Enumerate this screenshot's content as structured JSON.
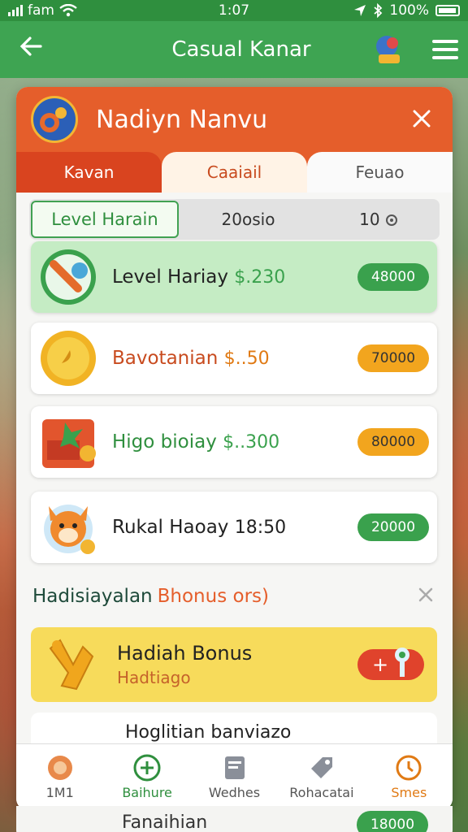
{
  "status_bar": {
    "carrier": "fam",
    "time": "1:07",
    "battery": "100%"
  },
  "app_bar": {
    "title": "Casual Kanar"
  },
  "dialog": {
    "title": "Nadiyn Nanvu",
    "tabs": [
      "Kavan",
      "Caaiail",
      "Feuao"
    ],
    "segments": [
      "Level Harain",
      "20osio",
      "10"
    ],
    "rewards": [
      {
        "name": "Level Hariay",
        "amount": "$.230",
        "value": "48000",
        "name_color": "#222",
        "amount_color": "#3aa14d",
        "pill": "green",
        "icon": "wrench-icon"
      },
      {
        "name": "Bavotanian",
        "amount": "$..50",
        "value": "70000",
        "name_color": "#c84b1f",
        "amount_color": "#e07a14",
        "pill": "orange",
        "icon": "coin-icon"
      },
      {
        "name": "Higo bioiay",
        "amount": "$..300",
        "value": "80000",
        "name_color": "#2f8f3e",
        "amount_color": "#3aa14d",
        "pill": "orange",
        "icon": "gift-box-icon"
      },
      {
        "name": "Rukal Haoay",
        "amount": "18:50",
        "value": "20000",
        "name_color": "#222",
        "amount_color": "#222",
        "pill": "green",
        "icon": "mascot-icon"
      }
    ],
    "section": {
      "title": "Hadisiayalan",
      "highlight": "Bhonus ors)"
    },
    "bonus": {
      "title": "Hadiah Bonus",
      "subtitle": "Hadtiago",
      "button": "+"
    },
    "peek_item": {
      "name": "Hoglitian banviazo"
    },
    "bottom_nav": [
      {
        "label": "1M1",
        "icon": "mascot-icon"
      },
      {
        "label": "Baihure",
        "icon": "plus-icon"
      },
      {
        "label": "Wedhes",
        "icon": "document-icon"
      },
      {
        "label": "Rohacatai",
        "icon": "tag-icon"
      },
      {
        "label": "Smes",
        "icon": "clock-icon"
      }
    ]
  },
  "under_item": {
    "name": "Fanaihian",
    "value": "18000"
  }
}
